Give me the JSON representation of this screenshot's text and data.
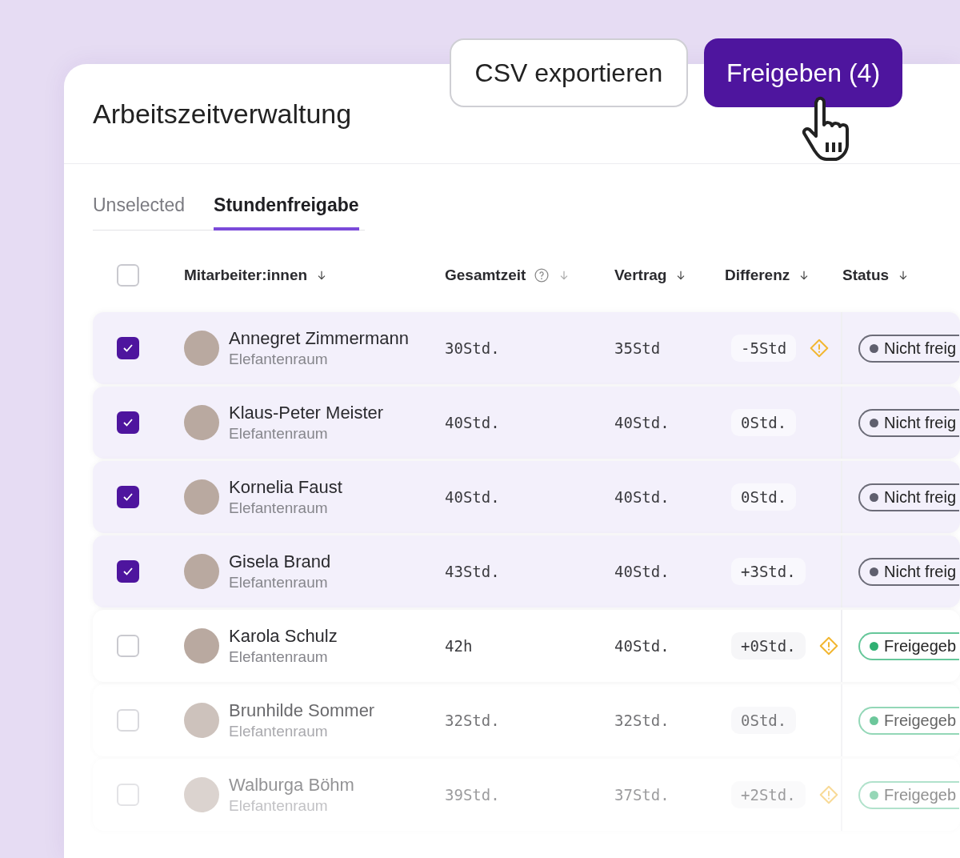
{
  "header": {
    "title": "Arbeitszeitverwaltung",
    "buttons": [
      {
        "label": "CSV exportieren",
        "kind": "secondary"
      },
      {
        "label": "Freigeben (4)",
        "kind": "primary"
      }
    ]
  },
  "tabs": [
    {
      "label": "Unselected",
      "selected": false
    },
    {
      "label": "Stundenfreigabe",
      "selected": true
    }
  ],
  "table": {
    "select_all": {
      "checked": false
    },
    "columns": [
      {
        "label": "Mitarbeiter:innen",
        "help": false
      },
      {
        "label": "Gesamtzeit",
        "help": true
      },
      {
        "label": "Vertrag",
        "help": false
      },
      {
        "label": "Differenz",
        "help": false
      },
      {
        "label": "Status",
        "help": false
      }
    ],
    "rows": [
      {
        "checked": true,
        "name": "Annegret Zimmermann",
        "group": "Elefantenraum",
        "total": "30Std.",
        "contract": "35Std",
        "difference": "-5Std",
        "warning": true,
        "status": "Nicht freig",
        "approved": false
      },
      {
        "checked": true,
        "name": "Klaus-Peter Meister",
        "group": "Elefantenraum",
        "total": "40Std.",
        "contract": "40Std.",
        "difference": "0Std.",
        "warning": false,
        "status": "Nicht freig",
        "approved": false
      },
      {
        "checked": true,
        "name": "Kornelia Faust",
        "group": "Elefantenraum",
        "total": "40Std.",
        "contract": "40Std.",
        "difference": "0Std.",
        "warning": false,
        "status": "Nicht freig",
        "approved": false
      },
      {
        "checked": true,
        "name": "Gisela Brand",
        "group": "Elefantenraum",
        "total": "43Std.",
        "contract": "40Std.",
        "difference": "+3Std.",
        "warning": false,
        "status": "Nicht freig",
        "approved": false
      },
      {
        "checked": false,
        "name": "Karola Schulz",
        "group": "Elefantenraum",
        "total": "42h",
        "contract": "40Std.",
        "difference": "+0Std.",
        "warning": true,
        "status": "Freigegeb",
        "approved": true
      },
      {
        "checked": false,
        "name": "Brunhilde Sommer",
        "group": "Elefantenraum",
        "total": "32Std.",
        "contract": "32Std.",
        "difference": "0Std.",
        "warning": false,
        "status": "Freigegeb",
        "approved": true
      },
      {
        "checked": false,
        "name": "Walburga Böhm",
        "group": "Elefantenraum",
        "total": "39Std.",
        "contract": "37Std.",
        "difference": "+2Std.",
        "warning": true,
        "status": "Freigegeb",
        "approved": true
      }
    ]
  }
}
